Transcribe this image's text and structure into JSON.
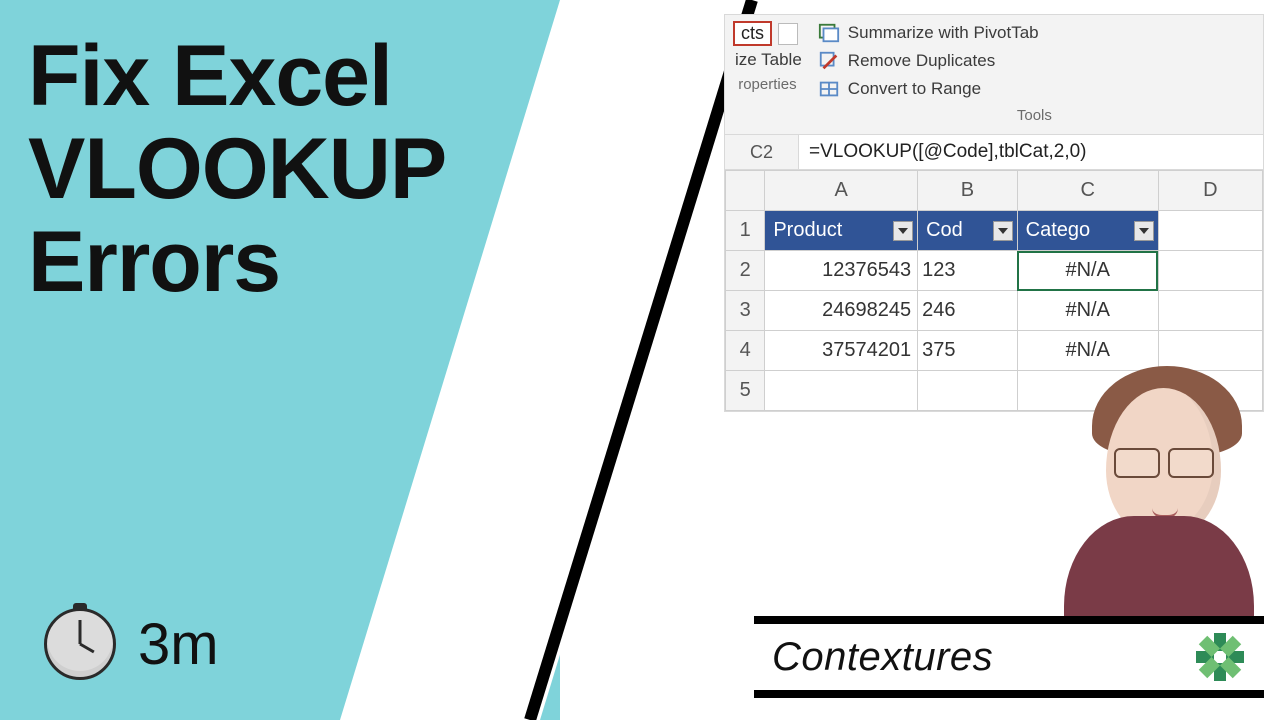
{
  "title_lines": [
    "Fix Excel",
    "VLOOKUP",
    "Errors"
  ],
  "duration": "3m",
  "brand": "Contextures",
  "excel": {
    "ribbon": {
      "left_frag1": "cts",
      "left_frag2": "ize Table",
      "left_group": "roperties",
      "tools_group": "Tools",
      "btn_pivot": "Summarize with PivotTab",
      "btn_dup": "Remove Duplicates",
      "btn_range": "Convert to Range"
    },
    "name_box": "C2",
    "formula": "=VLOOKUP([@Code],tblCat,2,0)",
    "cols": [
      "A",
      "B",
      "C",
      "D"
    ],
    "headers": [
      "Product",
      "Cod",
      "Catego"
    ],
    "rows": [
      {
        "n": "1"
      },
      {
        "n": "2",
        "a": "12376543",
        "b": "123",
        "c": "#N/A"
      },
      {
        "n": "3",
        "a": "24698245",
        "b": "246",
        "c": "#N/A"
      },
      {
        "n": "4",
        "a": "37574201",
        "b": "375",
        "c": "#N/A"
      },
      {
        "n": "5"
      }
    ]
  }
}
